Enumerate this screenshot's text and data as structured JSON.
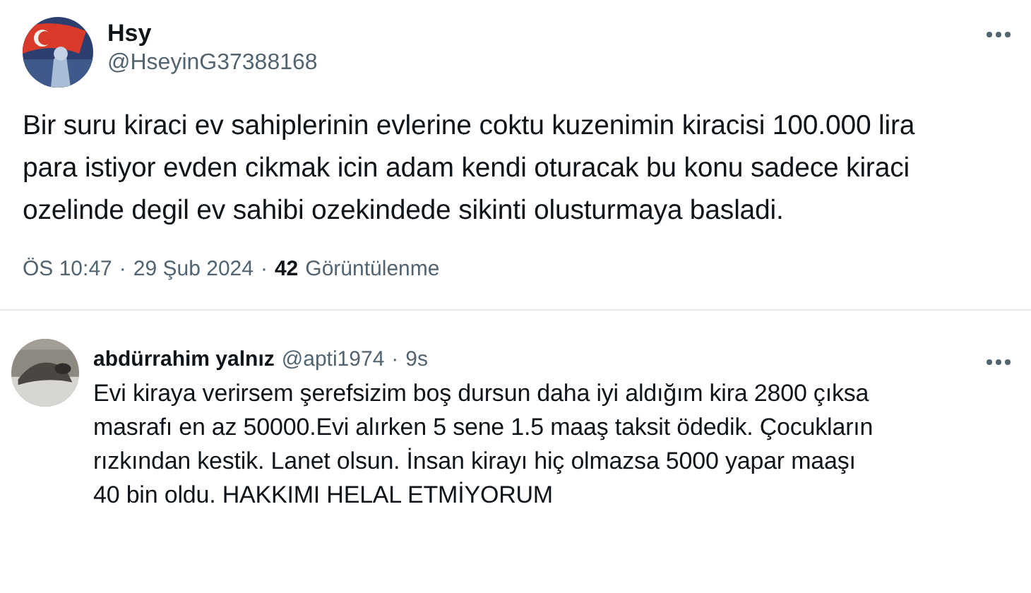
{
  "post": {
    "name": "Hsy",
    "handle": "@HseyinG37388168",
    "text": "Bir suru kiraci ev sahiplerinin evlerine coktu kuzenimin kiracisi 100.000 lira para istiyor evden cikmak icin adam kendi oturacak bu konu sadece kiraci ozelinde degil ev sahibi ozekindede sikinti olusturmaya basladi.",
    "time": "ÖS 10:47",
    "separator_1": "·",
    "date": "29 Şub 2024",
    "separator_2": "·",
    "views": "42",
    "views_label": "Görüntülenme"
  },
  "reply": {
    "name": "abdürrahim yalnız",
    "handle": "@apti1974",
    "separator": "·",
    "age": "9s",
    "text": "Evi kiraya verirsem şerefsizim boş dursun daha iyi aldığım kira 2800 çıksa masrafı en az 50000.Evi alırken 5 sene 1.5 maaş taksit ödedik. Çocukların rızkından kestik. Lanet olsun. İnsan kirayı hiç olmazsa 5000 yapar maaşı 40 bin oldu. HAKKIMI HELAL ETMİYORUM"
  }
}
